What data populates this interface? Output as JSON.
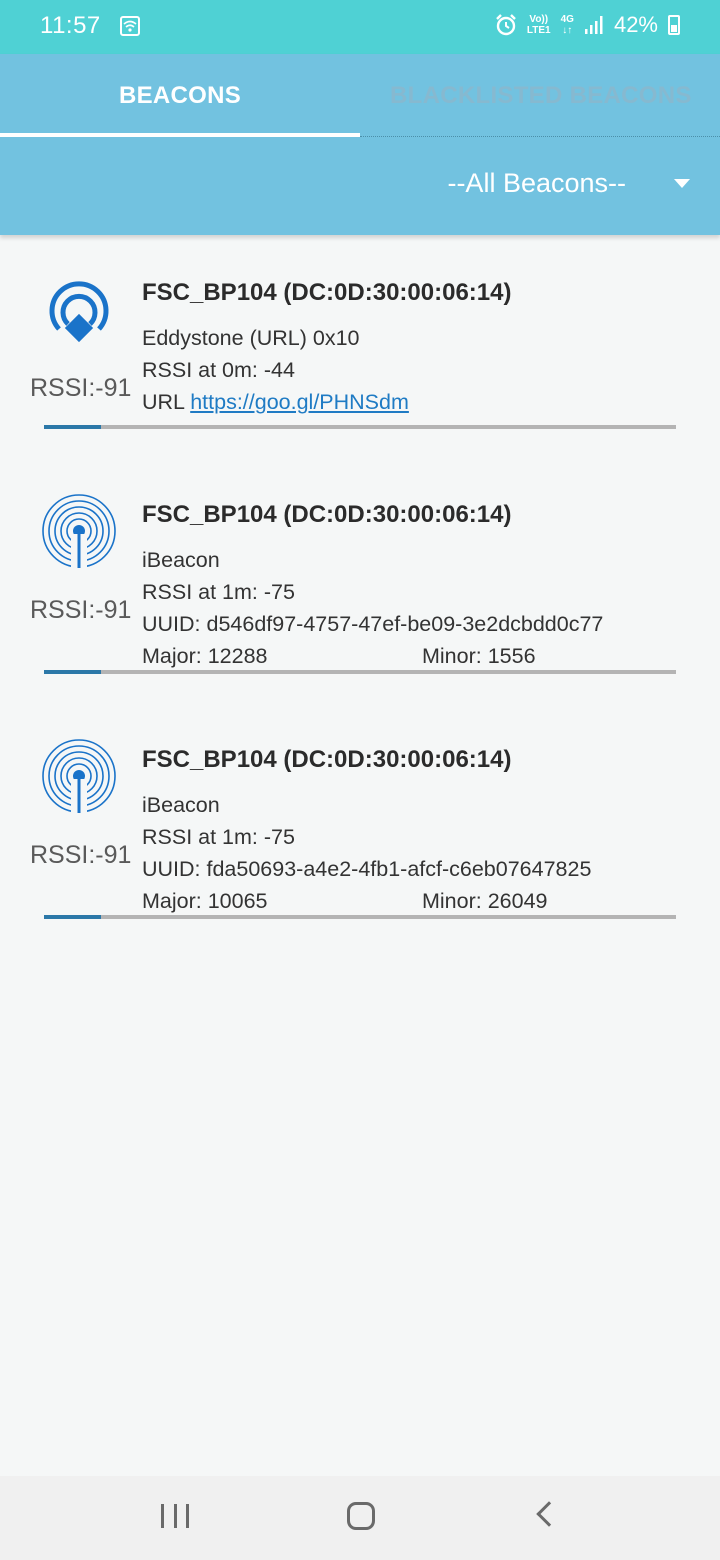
{
  "status_bar": {
    "time": "11:57",
    "network_top": "Vo))",
    "network_bottom": "LTE1",
    "data_top": "4G",
    "data_bottom": "↓↑",
    "battery": "42%"
  },
  "tabs": [
    {
      "label": "BEACONS",
      "selected": true
    },
    {
      "label": "BLACKLISTED BEACONS",
      "selected": false
    }
  ],
  "filter": {
    "selected": "--All Beacons--"
  },
  "beacons": [
    {
      "icon": "eddystone-icon",
      "title": "FSC_BP104 (DC:0D:30:00:06:14)",
      "type": "Eddystone (URL) 0x10",
      "rssi_ref": "RSSI at 0m: -44",
      "url_label": "URL",
      "url": "https://goo.gl/PHNSdm",
      "rssi": "RSSI:-91",
      "signal_fraction": 0.09
    },
    {
      "icon": "ibeacon-icon",
      "title": "FSC_BP104 (DC:0D:30:00:06:14)",
      "type": "iBeacon",
      "rssi_ref": "RSSI at 1m: -75",
      "uuid": "UUID: d546df97-4757-47ef-be09-3e2dcbdd0c77",
      "major": "Major: 12288",
      "minor": "Minor: 1556",
      "rssi": "RSSI:-91",
      "signal_fraction": 0.09
    },
    {
      "icon": "ibeacon-icon",
      "title": "FSC_BP104 (DC:0D:30:00:06:14)",
      "type": "iBeacon",
      "rssi_ref": "RSSI at 1m: -75",
      "uuid": "UUID: fda50693-a4e2-4fb1-afcf-c6eb07647825",
      "major": "Major: 10065",
      "minor": "Minor: 26049",
      "rssi": "RSSI:-91",
      "signal_fraction": 0.09
    }
  ],
  "colors": {
    "status_bar": "#4fd1d4",
    "app_bar": "#72c2e0",
    "accent": "#1f7bc4",
    "signal": "#2b78a8"
  }
}
